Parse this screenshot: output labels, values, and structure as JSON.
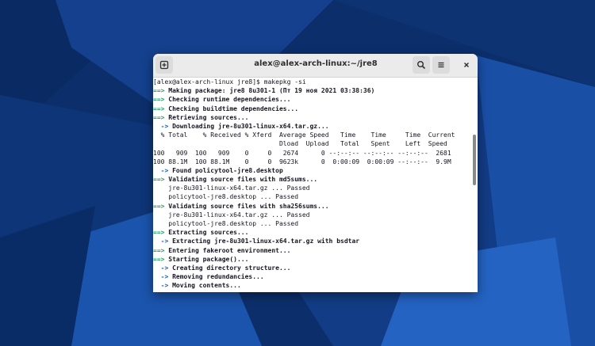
{
  "window": {
    "title": "alex@alex-arch-linux:~/jre8"
  },
  "icons": {
    "new_tab": "new-tab-icon",
    "search": "search-icon",
    "menu": "hamburger-menu-icon",
    "close": "close-icon"
  },
  "colors": {
    "arrow_green": "#26a269",
    "arrow_blue": "#1a5fb4",
    "wallpaper_dark": "#0b2f6e",
    "wallpaper_light": "#1e5bb8"
  },
  "terminal": {
    "partial_top": "                                                            ",
    "lines": [
      {
        "type": "plain",
        "text": "[alex@alex-arch-linux jre8]$ makepkg -si"
      },
      {
        "type": "main",
        "arrow": "==>",
        "text": " Making package: jre8 8u301-1 (Пт 19 ноя 2021 03:38:36)"
      },
      {
        "type": "main",
        "arrow": "==>",
        "text": " Checking runtime dependencies..."
      },
      {
        "type": "main",
        "arrow": "==>",
        "text": " Checking buildtime dependencies..."
      },
      {
        "type": "main",
        "arrow": "==>",
        "text": " Retrieving sources..."
      },
      {
        "type": "sub",
        "arrow": "  ->",
        "text": " Downloading jre-8u301-linux-x64.tar.gz..."
      },
      {
        "type": "plain",
        "text": "  % Total    % Received % Xferd  Average Speed   Time    Time     Time  Current"
      },
      {
        "type": "plain",
        "text": "                                 Dload  Upload   Total   Spent    Left  Speed"
      },
      {
        "type": "plain",
        "text": "100   909  100   909    0     0   2674      0 --:--:-- --:--:-- --:--:--  2681"
      },
      {
        "type": "plain",
        "text": "100 88.1M  100 88.1M    0     0  9623k      0  0:00:09  0:00:09 --:--:--  9.9M"
      },
      {
        "type": "sub",
        "arrow": "  ->",
        "text": " Found policytool-jre8.desktop"
      },
      {
        "type": "main",
        "arrow": "==>",
        "text": " Validating source files with md5sums..."
      },
      {
        "type": "plain",
        "text": "    jre-8u301-linux-x64.tar.gz ... Passed"
      },
      {
        "type": "plain",
        "text": "    policytool-jre8.desktop ... Passed"
      },
      {
        "type": "main",
        "arrow": "==>",
        "text": " Validating source files with sha256sums..."
      },
      {
        "type": "plain",
        "text": "    jre-8u301-linux-x64.tar.gz ... Passed"
      },
      {
        "type": "plain",
        "text": "    policytool-jre8.desktop ... Passed"
      },
      {
        "type": "main",
        "arrow": "==>",
        "text": " Extracting sources..."
      },
      {
        "type": "sub",
        "arrow": "  ->",
        "text": " Extracting jre-8u301-linux-x64.tar.gz with bsdtar"
      },
      {
        "type": "main",
        "arrow": "==>",
        "text": " Entering fakeroot environment..."
      },
      {
        "type": "main",
        "arrow": "==>",
        "text": " Starting package()..."
      },
      {
        "type": "sub",
        "arrow": "  ->",
        "text": " Creating directory structure..."
      },
      {
        "type": "sub",
        "arrow": "  ->",
        "text": " Removing redundancies..."
      },
      {
        "type": "sub",
        "arrow": "  ->",
        "text": " Moving contents..."
      }
    ]
  }
}
